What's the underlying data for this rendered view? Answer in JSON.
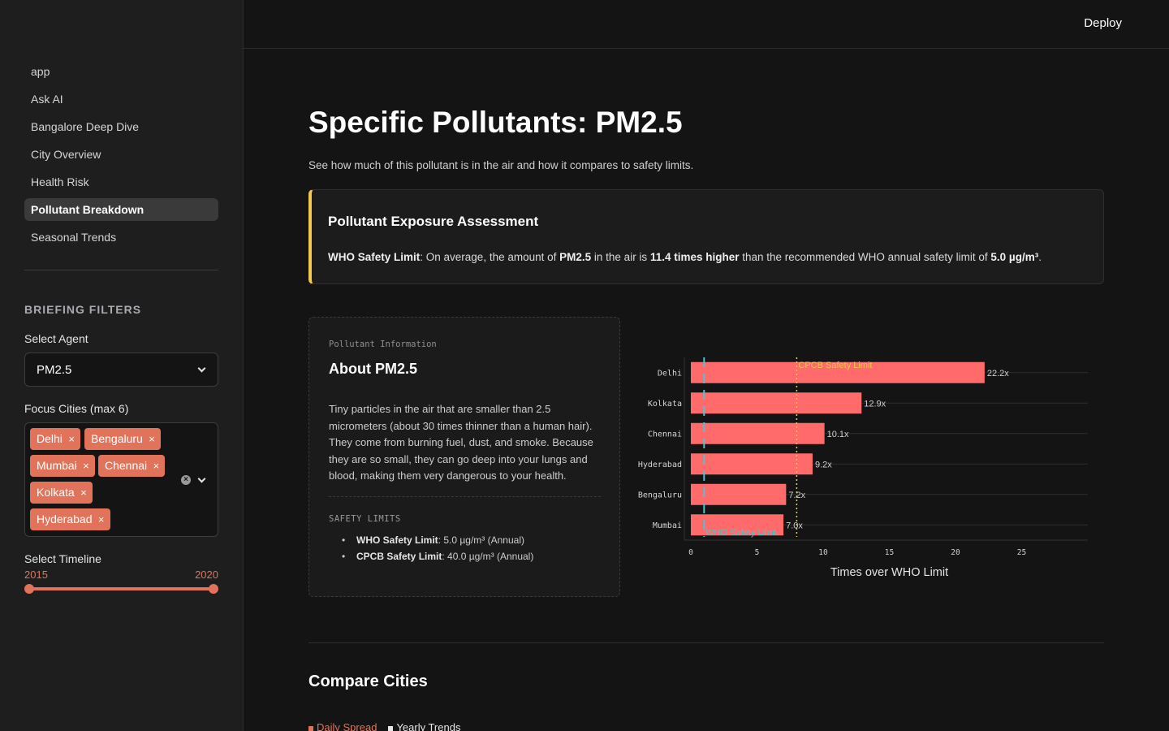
{
  "header": {
    "deploy_label": "Deploy"
  },
  "sidebar": {
    "nav": [
      "app",
      "Ask AI",
      "Bangalore Deep Dive",
      "City Overview",
      "Health Risk",
      "Pollutant Breakdown",
      "Seasonal Trends"
    ],
    "active_index": 5,
    "filters_title": "BRIEFING FILTERS",
    "agent_label": "Select Agent",
    "agent_value": "PM2.5",
    "cities_label": "Focus Cities (max 6)",
    "cities": [
      "Delhi",
      "Bengaluru",
      "Mumbai",
      "Chennai",
      "Kolkata",
      "Hyderabad"
    ],
    "timeline_label": "Select Timeline",
    "timeline_start": "2015",
    "timeline_end": "2020"
  },
  "main": {
    "title": "Specific Pollutants: PM2.5",
    "subtitle": "See how much of this pollutant is in the air and how it compares to safety limits.",
    "assessment": {
      "title": "Pollutant Exposure Assessment",
      "label": "WHO Safety Limit",
      "t1": ": On average, the amount of ",
      "pollutant": "PM2.5",
      "t2": " in the air is ",
      "multiple": "11.4 times higher",
      "t3": " than the recommended WHO annual safety limit of ",
      "limit": "5.0 µg/m³",
      "t4": "."
    },
    "info": {
      "eyebrow": "Pollutant Information",
      "title": "About PM2.5",
      "description": "Tiny particles in the air that are smaller than 2.5 micrometers (about 30 times thinner than a human hair). They come from burning fuel, dust, and smoke. Because they are so small, they can go deep into your lungs and blood, making them very dangerous to your health.",
      "limits_title": "SAFETY LIMITS",
      "limits": [
        {
          "label": "WHO Safety Limit",
          "value": ": 5.0 µg/m³ (Annual)"
        },
        {
          "label": "CPCB Safety Limit",
          "value": ": 40.0 µg/m³ (Annual)"
        }
      ]
    },
    "compare_title": "Compare Cities",
    "tabs": [
      "Daily Spread",
      "Yearly Trends"
    ]
  },
  "chart_data": {
    "type": "bar",
    "orientation": "horizontal",
    "categories": [
      "Delhi",
      "Kolkata",
      "Chennai",
      "Hyderabad",
      "Bengaluru",
      "Mumbai"
    ],
    "values": [
      22.2,
      12.9,
      10.1,
      9.2,
      7.2,
      7.0
    ],
    "data_labels": [
      "22.2x",
      "12.9x",
      "10.1x",
      "9.2x",
      "7.2x",
      "7.0x"
    ],
    "xlabel": "Times over WHO Limit",
    "xlim": [
      0,
      30
    ],
    "xticks": [
      0,
      5,
      10,
      15,
      20,
      25
    ],
    "bar_color": "#ff6b6b",
    "reference_lines": [
      {
        "name": "WHO Safety Limit",
        "x": 1,
        "color": "#4ec3cf"
      },
      {
        "name": "CPCB Safety Limit",
        "x": 8,
        "color": "#f2c94c"
      }
    ]
  }
}
